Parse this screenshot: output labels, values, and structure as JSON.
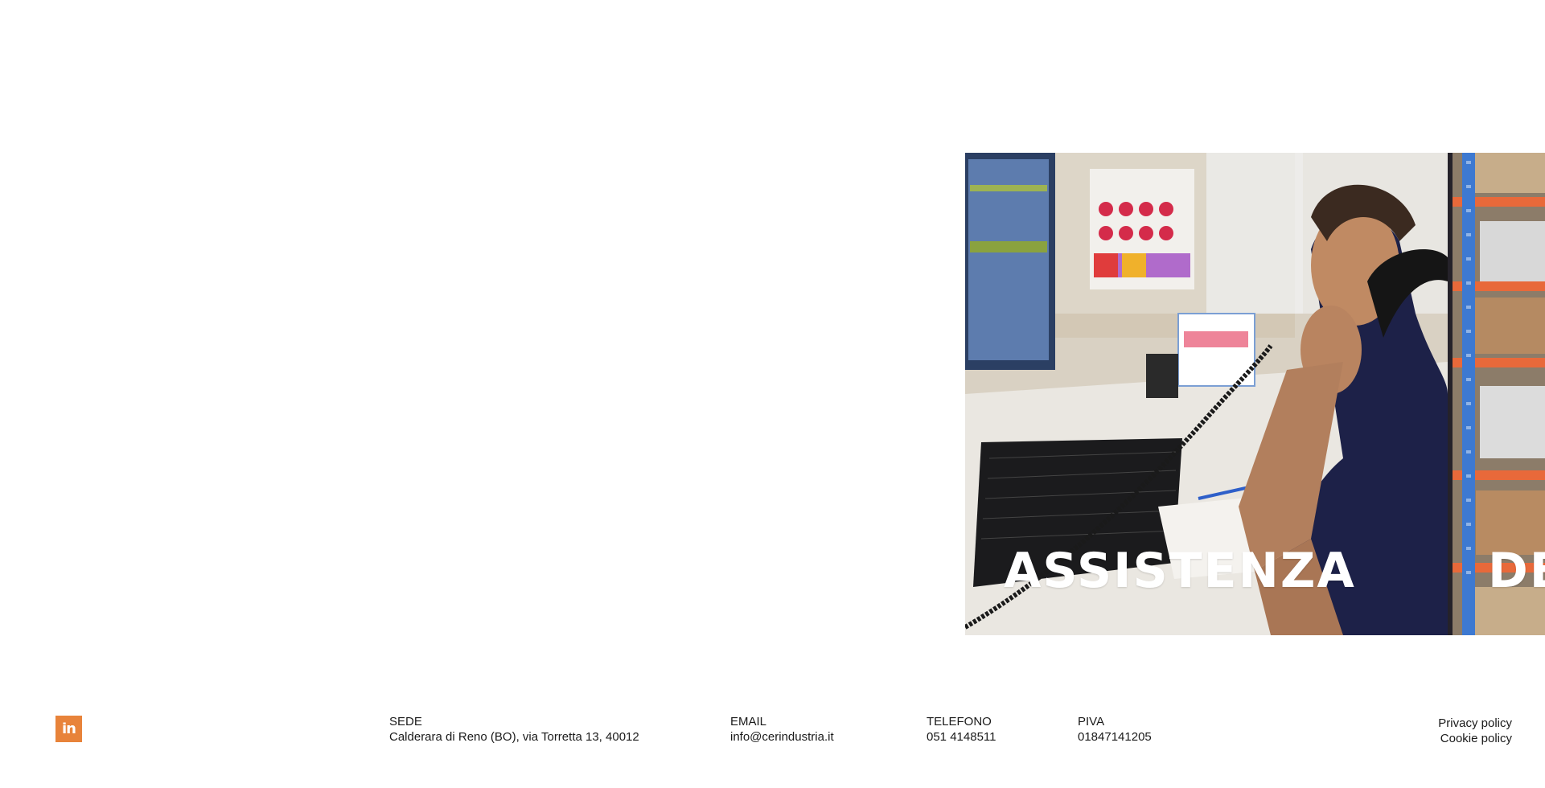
{
  "slider": {
    "slides": [
      {
        "title": "ASSISTENZA"
      },
      {
        "title": "DE"
      }
    ]
  },
  "footer": {
    "linkedin_label": "in",
    "sede": {
      "label": "SEDE",
      "value": "Calderara di Reno (BO), via Torretta 13, 40012"
    },
    "email": {
      "label": "EMAIL",
      "value": "info@cerindustria.it"
    },
    "telefono": {
      "label": "TELEFONO",
      "value": "051 4148511"
    },
    "piva": {
      "label": "PIVA",
      "value": "01847141205"
    },
    "legal": {
      "privacy": "Privacy policy",
      "cookie": "Cookie policy"
    }
  },
  "colors": {
    "accent": "#e8833a",
    "text": "#1a1a1a"
  }
}
